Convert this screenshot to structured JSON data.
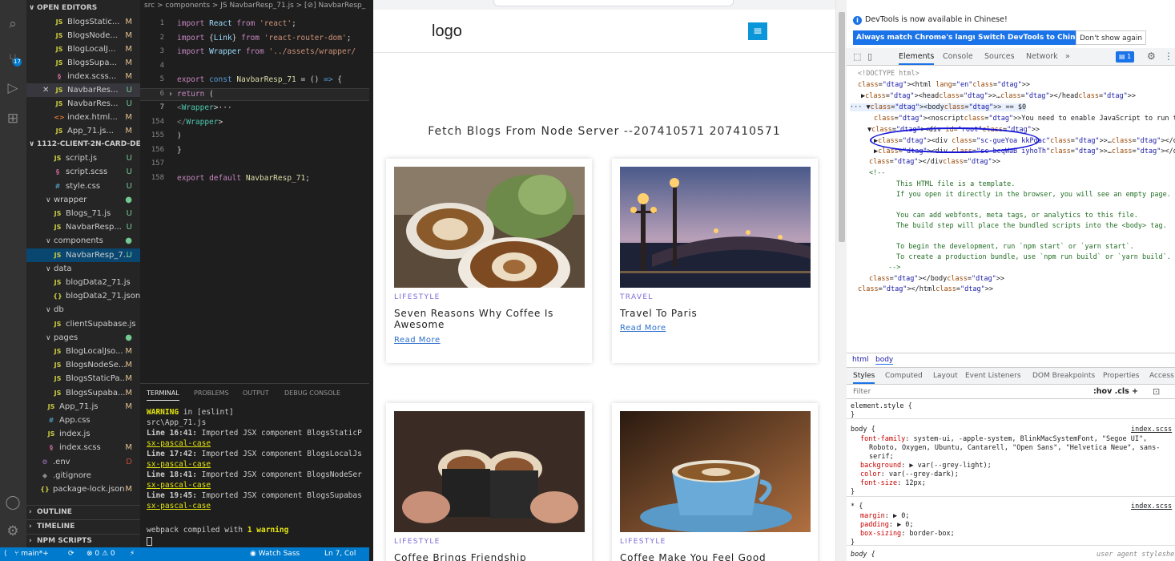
{
  "explorer": {
    "open_editors_label": "OPEN EDITORS",
    "open_editors": [
      {
        "name": "BlogsStatic...",
        "status": "M",
        "icon": "js-icon"
      },
      {
        "name": "BlogsNode...",
        "status": "M",
        "icon": "js-icon"
      },
      {
        "name": "BlogLocalJ...",
        "status": "M",
        "icon": "js-icon"
      },
      {
        "name": "BlogsSupa...",
        "status": "M",
        "icon": "js-icon"
      },
      {
        "name": "index.scss...",
        "status": "M",
        "icon": "scss-icon"
      },
      {
        "name": "NavbarRes...",
        "status": "U",
        "icon": "js-icon"
      },
      {
        "name": "NavbarRes...",
        "status": "U",
        "icon": "js-icon"
      },
      {
        "name": "index.html...",
        "status": "M",
        "icon": "html-icon"
      },
      {
        "name": "App_71.js...",
        "status": "M",
        "icon": "js-icon"
      }
    ],
    "project_label": "1112-CLIENT-2N-CARD-DE...",
    "files": [
      {
        "name": "script.js",
        "status": "U",
        "icon": "js-icon",
        "indent": 2
      },
      {
        "name": "script.scss",
        "status": "U",
        "icon": "scss-icon",
        "indent": 2
      },
      {
        "name": "style.css",
        "status": "U",
        "icon": "css-icon",
        "indent": 2
      },
      {
        "name": "wrapper",
        "status": "●",
        "icon": "folder-icon",
        "indent": 1,
        "folder": true
      },
      {
        "name": "Blogs_71.js",
        "status": "U",
        "icon": "js-icon",
        "indent": 2
      },
      {
        "name": "NavbarResp...",
        "status": "U",
        "icon": "js-icon",
        "indent": 2
      },
      {
        "name": "components",
        "status": "●",
        "icon": "folder-icon",
        "indent": 1,
        "folder": true
      },
      {
        "name": "NavbarResp_7...",
        "status": "U",
        "icon": "js-icon",
        "indent": 2,
        "active": true
      },
      {
        "name": "data",
        "status": "",
        "icon": "folder-icon",
        "indent": 1,
        "folder": true
      },
      {
        "name": "blogData2_71.js",
        "status": "",
        "icon": "js-icon",
        "indent": 2
      },
      {
        "name": "blogData2_71.json",
        "status": "",
        "icon": "json-icon",
        "indent": 2
      },
      {
        "name": "db",
        "status": "",
        "icon": "folder-icon",
        "indent": 1,
        "folder": true
      },
      {
        "name": "clientSupabase.js",
        "status": "",
        "icon": "js-icon",
        "indent": 2
      },
      {
        "name": "pages",
        "status": "●",
        "icon": "folder-icon",
        "indent": 1,
        "folder": true
      },
      {
        "name": "BlogLocalJso...",
        "status": "M",
        "icon": "js-icon",
        "indent": 2
      },
      {
        "name": "BlogsNodeSe...",
        "status": "M",
        "icon": "js-icon",
        "indent": 2
      },
      {
        "name": "BlogsStaticPa...",
        "status": "M",
        "icon": "js-icon",
        "indent": 2
      },
      {
        "name": "BlogsSupaba...",
        "status": "M",
        "icon": "js-icon",
        "indent": 2
      },
      {
        "name": "App_71.js",
        "status": "M",
        "icon": "js-icon",
        "indent": 1
      },
      {
        "name": "App.css",
        "status": "",
        "icon": "css-icon",
        "indent": 1
      },
      {
        "name": "index.js",
        "status": "",
        "icon": "js-icon",
        "indent": 1
      },
      {
        "name": "index.scss",
        "status": "M",
        "icon": "scss-icon",
        "indent": 1
      },
      {
        "name": ".env",
        "status": "D",
        "icon": "env-icon",
        "indent": 0
      },
      {
        "name": ".gitignore",
        "status": "",
        "icon": "git-icon",
        "indent": 0
      },
      {
        "name": "package-lock.json",
        "status": "M",
        "icon": "json-icon",
        "indent": 0
      }
    ],
    "outline_label": "OUTLINE",
    "timeline_label": "TIMELINE",
    "npm_label": "NPM SCRIPTS"
  },
  "editor": {
    "breadcrumb": "src > components > JS NavbarResp_71.js > [⊘] NavbarResp_",
    "lines": [
      {
        "num": "1",
        "text": "import React from 'react';"
      },
      {
        "num": "2",
        "text": "import {Link} from 'react-router-dom';"
      },
      {
        "num": "3",
        "text": "import Wrapper from '../assets/wrapper/"
      },
      {
        "num": "4",
        "text": ""
      },
      {
        "num": "5",
        "text": "export const NavbarResp_71 = () => {"
      },
      {
        "num": "6",
        "text": "  return ("
      },
      {
        "num": "7",
        "text": "    <Wrapper>···"
      },
      {
        "num": "154",
        "text": "    </Wrapper>"
      },
      {
        "num": "155",
        "text": "  )"
      },
      {
        "num": "156",
        "text": "}"
      },
      {
        "num": "157",
        "text": ""
      },
      {
        "num": "158",
        "text": "export default NavbarResp_71;"
      }
    ]
  },
  "terminal": {
    "tabs": [
      "TERMINAL",
      "PROBLEMS",
      "OUTPUT",
      "DEBUG CONSOLE"
    ],
    "warning_label": "WARNING",
    "warning_rest": " in [eslint]",
    "file": "src\\App_71.js",
    "entries": [
      {
        "pos": "Line 16:41:",
        "msg": "  Imported JSX component BlogsStaticP",
        "rule": "sx-pascal-case"
      },
      {
        "pos": "Line 17:42:",
        "msg": "  Imported JSX component BlogsLocalJs",
        "rule": "sx-pascal-case"
      },
      {
        "pos": "Line 18:41:",
        "msg": "  Imported JSX component BlogsNodeSer",
        "rule": "sx-pascal-case"
      },
      {
        "pos": "Line 19:45:",
        "msg": "  Imported JSX component BlogsSupabas",
        "rule": "sx-pascal-case"
      }
    ],
    "compiled_prefix": "webpack compiled with ",
    "compiled_warn": "1 warning"
  },
  "statusbar": {
    "branch": "main*+",
    "sync": "⟳",
    "problems": "⊗ 0 ⚠ 0",
    "watch": "Watch Sass",
    "position": "Ln 7, Col"
  },
  "page": {
    "logo": "logo",
    "menu_icon": "≡",
    "heading": "Fetch Blogs From Node Server --207410571 207410571",
    "cards": [
      {
        "category": "LIFESTYLE",
        "title": "Seven Reasons Why Coffee Is Awesome",
        "link": "Read More",
        "image": "coffee-latte-art"
      },
      {
        "category": "TRAVEL",
        "title": "Travel To Paris",
        "link": "Read More",
        "image": "paris-bridge-night"
      },
      {
        "category": "LIFESTYLE",
        "title": "Coffee Brings Friendship",
        "link": "",
        "image": "coffee-cheers"
      },
      {
        "category": "LIFESTYLE",
        "title": "Coffee Make You Feel Good",
        "link": "",
        "image": "coffee-cup-blue"
      }
    ]
  },
  "devtools": {
    "info": "DevTools is now available in Chinese!",
    "btn_match": "Always match Chrome's language",
    "btn_switch": "Switch DevTools to Chinese",
    "btn_dont": "Don't show again",
    "tabs": [
      "Elements",
      "Console",
      "Sources",
      "Network",
      "»"
    ],
    "badge": "1",
    "dom": [
      "<!DOCTYPE html>",
      "<html lang=\"en\">",
      "▶<head>…</head>",
      "··· ▼<body> == $0",
      "<noscript>You need to enable JavaScript to run this app.</noscript>",
      "▼<div id=\"root\">",
      "▶<div class=\"sc-gueYoa kkPgac\">…</div>",
      "▶<div class=\"sc-beqWaB iyhoTh\">…</div>",
      "</div>",
      "<!--",
      "This HTML file is a template.",
      "If you open it directly in the browser, you will see an empty page.",
      "You can add webfonts, meta tags, or analytics to this file.",
      "The build step will place the bundled scripts into the <body> tag.",
      "To begin the development, run `npm start` or `yarn start`.",
      "To create a production bundle, use `npm run build` or `yarn build`.",
      "-->",
      "</body>",
      "</html>"
    ],
    "crumbs": [
      "html",
      "body"
    ],
    "style_tabs": [
      "Styles",
      "Computed",
      "Layout",
      "Event Listeners",
      "DOM Breakpoints",
      "Properties",
      "Access"
    ],
    "filter_placeholder": "Filter",
    "filter_tools": ":hov .cls +",
    "styles": [
      "element.style {",
      "}",
      "body {",
      "font-family: system-ui, -apple-system, BlinkMacSystemFont, \"Segoe UI\",",
      "Roboto, Oxygen, Ubuntu, Cantarell, \"Open Sans\", \"Helvetica Neue\", sans-",
      "serif;",
      "background: ▶ var(--grey-light);",
      "color: var(--grey-dark);",
      "font-size: 12px;",
      "}",
      "* {",
      "margin: ▶ 0;",
      "padding: ▶ 0;",
      "box-sizing: border-box;",
      "}",
      "body {",
      "index.scss",
      "index.scss",
      "user agent styleshe"
    ]
  }
}
